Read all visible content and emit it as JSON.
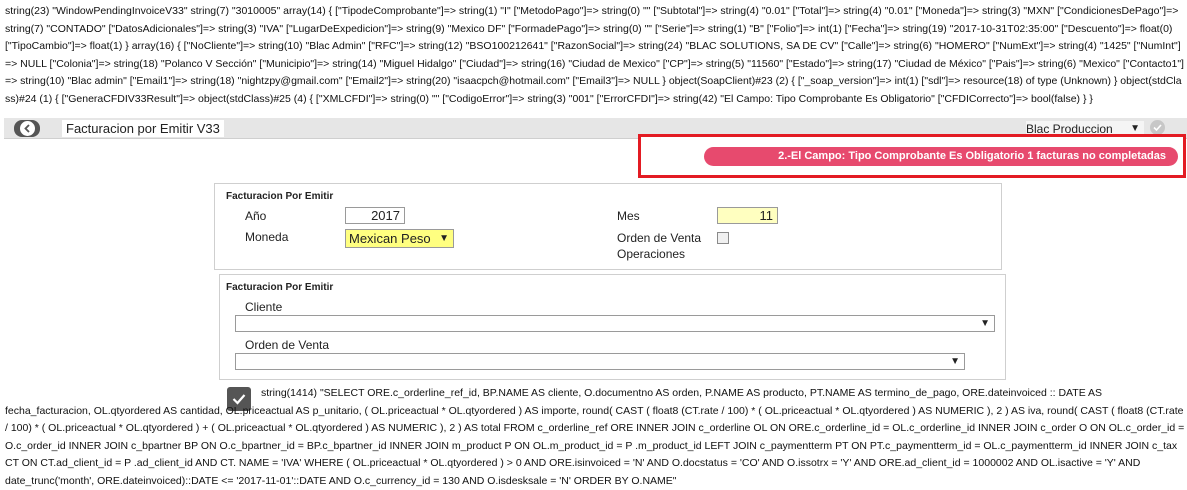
{
  "debug": {
    "dump_text": "string(23) \"WindowPendingInvoiceV33\" string(7) \"3010005\" array(14) { [\"TipodeComprobante\"]=> string(1) \"I\" [\"MetodoPago\"]=> string(0) \"\" [\"Subtotal\"]=> string(4) \"0.01\" [\"Total\"]=> string(4) \"0.01\" [\"Moneda\"]=> string(3) \"MXN\" [\"CondicionesDePago\"]=> string(7) \"CONTADO\" [\"DatosAdicionales\"]=> string(3) \"IVA\" [\"LugarDeExpedicion\"]=> string(9) \"Mexico DF\" [\"FormadePago\"]=> string(0) \"\" [\"Serie\"]=> string(1) \"B\" [\"Folio\"]=> int(1) [\"Fecha\"]=> string(19) \"2017-10-31T02:35:00\" [\"Descuento\"]=> float(0) [\"TipoCambio\"]=> float(1) } array(16) { [\"NoCliente\"]=> string(10) \"Blac Admin\" [\"RFC\"]=> string(12) \"BSO100212641\" [\"RazonSocial\"]=> string(24) \"BLAC SOLUTIONS, SA DE CV\" [\"Calle\"]=> string(6) \"HOMERO\" [\"NumExt\"]=> string(4) \"1425\" [\"NumInt\"]=> NULL [\"Colonia\"]=> string(18) \"Polanco V Sección\" [\"Municipio\"]=> string(14) \"Miguel Hidalgo\" [\"Ciudad\"]=> string(16) \"Ciudad de Mexico\" [\"CP\"]=> string(5) \"11560\" [\"Estado\"]=> string(17) \"Ciudad de México\" [\"Pais\"]=> string(6) \"Mexico\" [\"Contacto1\"]=> string(10) \"Blac admin\" [\"Email1\"]=> string(18) \"nightzpy@gmail.com\" [\"Email2\"]=> string(20) \"isaacpch@hotmail.com\" [\"Email3\"]=> NULL } object(SoapClient)#23 (2) { [\"_soap_version\"]=> int(1) [\"sdl\"]=> resource(18) of type (Unknown) } object(stdClass)#24 (1) { [\"GeneraCFDIV33Result\"]=> object(stdClass)#25 (4) { [\"XMLCFDI\"]=> string(0) \"\" [\"CodigoError\"]=> string(3) \"001\" [\"ErrorCFDI\"]=> string(42) \"El Campo: Tipo Comprobante Es Obligatorio\" [\"CFDICorrecto\"]=> bool(false) } }",
    "sql_text": "string(1414) \"SELECT ORE.c_orderline_ref_id, BP.NAME AS cliente, O.documentno AS orden, P.NAME AS producto, PT.NAME AS termino_de_pago, ORE.dateinvoiced :: DATE AS fecha_facturacion, OL.qtyordered AS cantidad, OL.priceactual AS p_unitario, ( OL.priceactual * OL.qtyordered ) AS importe, round( CAST ( float8 (CT.rate / 100) * ( OL.priceactual * OL.qtyordered ) AS NUMERIC ), 2 ) AS iva, round( CAST ( float8 (CT.rate / 100) * ( OL.priceactual * OL.qtyordered ) + ( OL.priceactual * OL.qtyordered ) AS NUMERIC ), 2 ) AS total FROM c_orderline_ref ORE INNER JOIN c_orderline OL ON ORE.c_orderline_id = OL.c_orderline_id INNER JOIN c_order O ON OL.c_order_id = O.c_order_id INNER JOIN c_bpartner BP ON O.c_bpartner_id = BP.c_bpartner_id INNER JOIN m_product P ON OL.m_product_id = P .m_product_id LEFT JOIN c_paymentterm PT ON PT.c_paymentterm_id = OL.c_paymentterm_id INNER JOIN c_tax CT ON CT.ad_client_id = P .ad_client_id AND CT. NAME = 'IVA' WHERE ( OL.priceactual * OL.qtyordered ) > 0 AND ORE.isinvoiced = 'N' AND O.docstatus = 'CO' AND O.issotrx = 'Y' AND ORE.ad_client_id = 1000002 AND OL.isactive = 'Y' AND date_trunc('month', ORE.dateinvoiced)::DATE <= '2017-11-01'::DATE AND O.c_currency_id = 130 AND O.isdesksale = 'N' ORDER BY O.NAME\""
  },
  "toolbar": {
    "title": "Facturacion por Emitir V33",
    "org_select": "Blac Produccion"
  },
  "alert": {
    "message": "2.-El Campo: Tipo Comprobante Es Obligatorio 1 facturas no completadas"
  },
  "panel1": {
    "title": "Facturacion Por Emitir",
    "year_label": "Año",
    "year_value": "2017",
    "month_label": "Mes",
    "month_value": "11",
    "currency_label": "Moneda",
    "currency_value": "Mexican Peso",
    "sales_order_ops_label_1": "Orden de Venta",
    "sales_order_ops_label_2": "Operaciones"
  },
  "panel2": {
    "title": "Facturacion Por Emitir",
    "client_label": "Cliente",
    "client_value": "",
    "sales_order_label": "Orden de Venta",
    "sales_order_value": ""
  },
  "colors": {
    "alert_border": "#e31b23",
    "alert_pill": "#e74a6e",
    "required_field": "#ffff80"
  }
}
